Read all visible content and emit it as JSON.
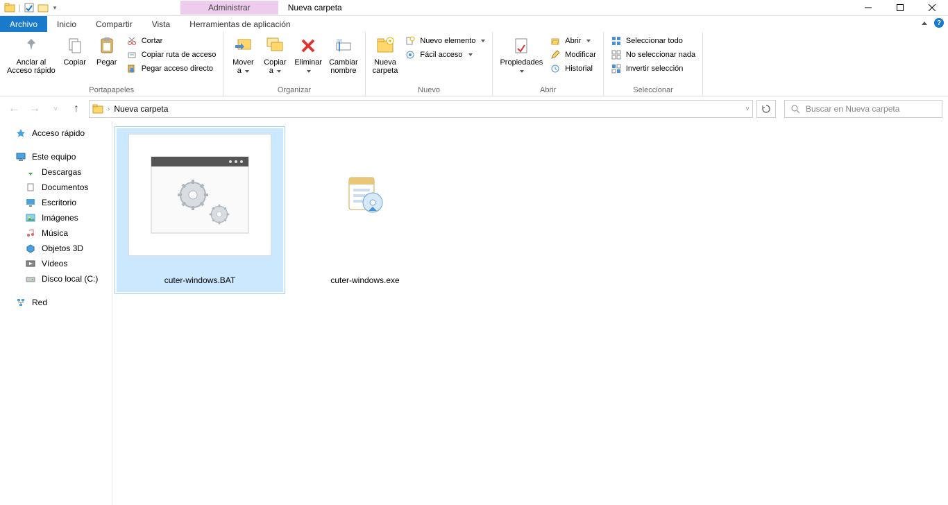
{
  "title": {
    "manage": "Administrar",
    "window": "Nueva carpeta"
  },
  "tabs": {
    "file": "Archivo",
    "home": "Inicio",
    "share": "Compartir",
    "view": "Vista",
    "apptools": "Herramientas de aplicación"
  },
  "ribbon": {
    "clipboard": {
      "pin": "Anclar al\nAcceso rápido",
      "copy": "Copiar",
      "paste": "Pegar",
      "cut": "Cortar",
      "copypath": "Copiar ruta de acceso",
      "pasteshortcut": "Pegar acceso directo",
      "group": "Portapapeles"
    },
    "organize": {
      "moveto": "Mover\na",
      "copyto": "Copiar\na",
      "delete": "Eliminar",
      "rename": "Cambiar\nnombre",
      "group": "Organizar"
    },
    "new": {
      "newfolder": "Nueva\ncarpeta",
      "newitem": "Nuevo elemento",
      "easyaccess": "Fácil acceso",
      "group": "Nuevo"
    },
    "open": {
      "properties": "Propiedades",
      "open": "Abrir",
      "edit": "Modificar",
      "history": "Historial",
      "group": "Abrir"
    },
    "select": {
      "selectall": "Seleccionar todo",
      "selectnone": "No seleccionar nada",
      "invert": "Invertir selección",
      "group": "Seleccionar"
    }
  },
  "address": {
    "location": "Nueva carpeta",
    "search_placeholder": "Buscar en Nueva carpeta"
  },
  "nav": {
    "quickaccess": "Acceso rápido",
    "thispc": "Este equipo",
    "downloads": "Descargas",
    "documents": "Documentos",
    "desktop": "Escritorio",
    "pictures": "Imágenes",
    "music": "Música",
    "objects3d": "Objetos 3D",
    "videos": "Vídeos",
    "localdisk": "Disco local (C:)",
    "network": "Red"
  },
  "files": [
    {
      "name": "cuter-windows.BAT",
      "selected": true,
      "highlighted": true,
      "type": "bat"
    },
    {
      "name": "cuter-windows.exe",
      "selected": false,
      "highlighted": false,
      "type": "exe"
    }
  ]
}
